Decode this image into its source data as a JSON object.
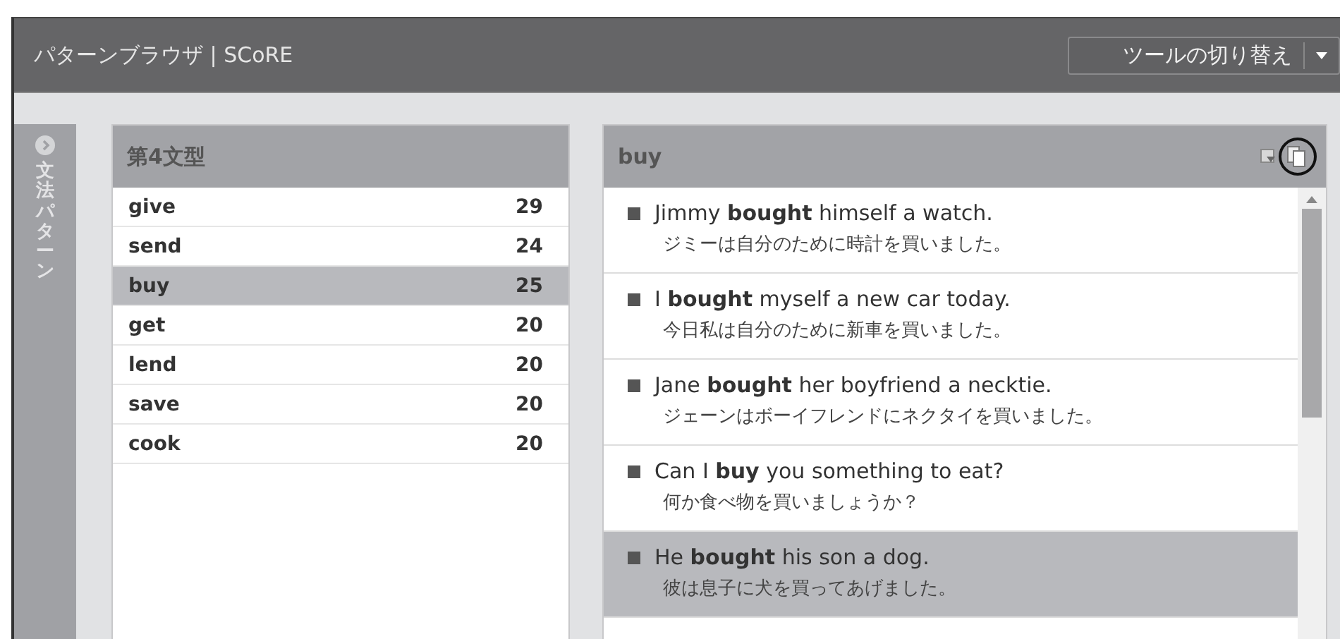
{
  "window": {
    "title": "パターンブラウザ | SCoRE",
    "tool_switch": "ツールの切り替え"
  },
  "sidebar": {
    "label": "文法パターン"
  },
  "pattern_list": {
    "title": "第4文型",
    "items": [
      {
        "word": "give",
        "count": "29",
        "selected": false
      },
      {
        "word": "send",
        "count": "24",
        "selected": false
      },
      {
        "word": "buy",
        "count": "25",
        "selected": true
      },
      {
        "word": "get",
        "count": "20",
        "selected": false
      },
      {
        "word": "lend",
        "count": "20",
        "selected": false
      },
      {
        "word": "save",
        "count": "20",
        "selected": false
      },
      {
        "word": "cook",
        "count": "20",
        "selected": false
      }
    ]
  },
  "examples": {
    "title": "buy",
    "items": [
      {
        "english": "Jimmy **bought** himself a watch.",
        "japanese": "ジミーは自分のために時計を買いました。",
        "selected": false
      },
      {
        "english": "I **bought** myself a new car today.",
        "japanese": "今日私は自分のために新車を買いました。",
        "selected": false
      },
      {
        "english": "Jane **bought** her boyfriend a necktie.",
        "japanese": "ジェーンはボーイフレンドにネクタイを買いました。",
        "selected": false
      },
      {
        "english": "Can I **buy** you something to eat?",
        "japanese": "何か食べ物を買いましょうか？",
        "selected": false
      },
      {
        "english": "He **bought** his son a dog.",
        "japanese": "彼は息子に犬を買ってあげました。",
        "selected": true
      }
    ]
  }
}
